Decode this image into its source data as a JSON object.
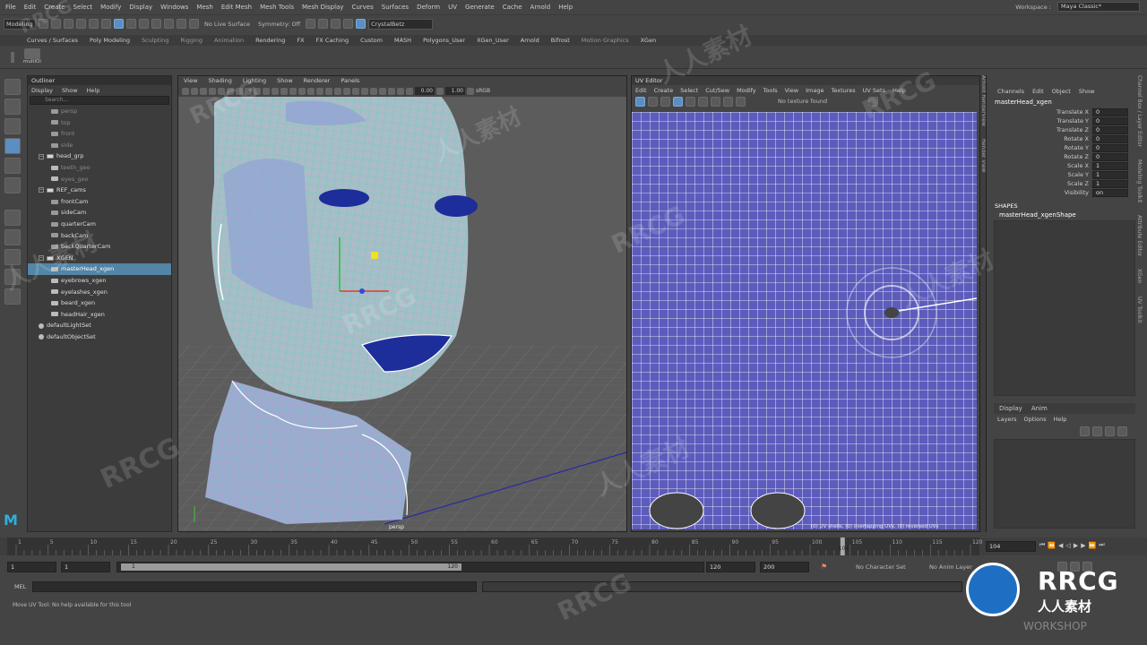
{
  "menubar": {
    "items": [
      "File",
      "Edit",
      "Create",
      "Select",
      "Modify",
      "Display",
      "Windows",
      "Mesh",
      "Edit Mesh",
      "Mesh Tools",
      "Mesh Display",
      "Curves",
      "Surfaces",
      "Deform",
      "UV",
      "Generate",
      "Cache",
      "Arnold",
      "Help"
    ]
  },
  "workspace": {
    "label": "Workspace :",
    "value": "Maya Classic*"
  },
  "statusline": {
    "mode": "Modeling",
    "live_surface": "No Live Surface",
    "symmetry": "Symmetry: Off",
    "user": "CrystalBetz"
  },
  "shelf": {
    "tabs": [
      "Curves / Surfaces",
      "Poly Modeling",
      "Sculpting",
      "Rigging",
      "Animation",
      "Rendering",
      "FX",
      "FX Caching",
      "Custom",
      "MASH",
      "Polygons_User",
      "XGen_User",
      "Arnold",
      "Bifrost",
      "Motion Graphics",
      "XGen"
    ],
    "tool_label": "multiOi"
  },
  "outliner": {
    "title": "Outliner",
    "menu": [
      "Display",
      "Show",
      "Help"
    ],
    "search_placeholder": "Search...",
    "items": [
      {
        "label": "persp",
        "level": 1,
        "icon": "cam",
        "dim": true
      },
      {
        "label": "top",
        "level": 1,
        "icon": "cam",
        "dim": true
      },
      {
        "label": "front",
        "level": 1,
        "icon": "cam",
        "dim": true
      },
      {
        "label": "side",
        "level": 1,
        "icon": "cam",
        "dim": true
      },
      {
        "label": "head_grp",
        "level": 0,
        "icon": "grp",
        "exp": true
      },
      {
        "label": "teeth_geo",
        "level": 1,
        "icon": "mesh",
        "dim": true
      },
      {
        "label": "eyes_geo",
        "level": 1,
        "icon": "mesh",
        "dim": true
      },
      {
        "label": "REF_cams",
        "level": 0,
        "icon": "grp",
        "exp": true
      },
      {
        "label": "frontCam",
        "level": 1,
        "icon": "cam"
      },
      {
        "label": "sideCam",
        "level": 1,
        "icon": "cam"
      },
      {
        "label": "quarterCam",
        "level": 1,
        "icon": "cam"
      },
      {
        "label": "backCam",
        "level": 1,
        "icon": "cam"
      },
      {
        "label": "backQuarterCam",
        "level": 1,
        "icon": "cam"
      },
      {
        "label": "XGEN",
        "level": 0,
        "icon": "grp",
        "exp": true
      },
      {
        "label": "masterHead_xgen",
        "level": 1,
        "icon": "mesh",
        "sel": true
      },
      {
        "label": "eyebrows_xgen",
        "level": 1,
        "icon": "mesh"
      },
      {
        "label": "eyelashes_xgen",
        "level": 1,
        "icon": "mesh"
      },
      {
        "label": "beard_xgen",
        "level": 1,
        "icon": "mesh"
      },
      {
        "label": "headHair_xgen",
        "level": 1,
        "icon": "mesh"
      },
      {
        "label": "defaultLightSet",
        "level": 0,
        "icon": "set"
      },
      {
        "label": "defaultObjectSet",
        "level": 0,
        "icon": "set"
      }
    ]
  },
  "viewport": {
    "menu": [
      "View",
      "Shading",
      "Lighting",
      "Show",
      "Renderer",
      "Panels"
    ],
    "val1": "0.00",
    "val2": "1.00",
    "colorspace": "sRGB",
    "camera": "persp"
  },
  "uv_editor": {
    "title": "UV Editor",
    "menu": [
      "Edit",
      "Create",
      "Select",
      "Cut/Sew",
      "Modify",
      "Tools",
      "View",
      "Image",
      "Textures",
      "UV Sets",
      "Help"
    ],
    "texture": "No texture found",
    "status": "(0) UV shells, (0) overlapping UVs, (0) reversed UVs"
  },
  "channel_box": {
    "menu": [
      "Channels",
      "Edit",
      "Object",
      "Show"
    ],
    "object": "masterHead_xgen",
    "attrs": [
      {
        "k": "Translate X",
        "v": "0"
      },
      {
        "k": "Translate Y",
        "v": "0"
      },
      {
        "k": "Translate Z",
        "v": "0"
      },
      {
        "k": "Rotate X",
        "v": "0"
      },
      {
        "k": "Rotate Y",
        "v": "0"
      },
      {
        "k": "Rotate Z",
        "v": "0"
      },
      {
        "k": "Scale X",
        "v": "1"
      },
      {
        "k": "Scale Y",
        "v": "1"
      },
      {
        "k": "Scale Z",
        "v": "1"
      },
      {
        "k": "Visibility",
        "v": "on"
      }
    ],
    "shapes_label": "SHAPES",
    "shape": "masterHead_xgenShape",
    "layer_tabs": [
      "Display",
      "Anim"
    ],
    "layer_menu": [
      "Layers",
      "Options",
      "Help"
    ]
  },
  "side_tabs": [
    "Channel Box / Layer Editor",
    "Modeling Toolkit",
    "Attribute Editor",
    "XGen",
    "UV Toolkit"
  ],
  "side_tabs_left": [
    "Arnold RenderView",
    "Render View"
  ],
  "timeline": {
    "ticks": [
      "1",
      "5",
      "10",
      "15",
      "20",
      "25",
      "30",
      "35",
      "40",
      "45",
      "50",
      "55",
      "60",
      "65",
      "70",
      "75",
      "80",
      "85",
      "90",
      "95",
      "100",
      "105",
      "110",
      "115",
      "120"
    ],
    "current": "104",
    "current_frame": "104"
  },
  "range": {
    "start": "1",
    "inner_start": "1",
    "slider_start": "1",
    "slider_end": "120",
    "end": "120",
    "anim_end": "200",
    "char_set": "No Character Set",
    "anim_layer": "No Anim Layer"
  },
  "mel": {
    "label": "MEL"
  },
  "help_line": "Move UV Tool: No help available for this tool",
  "watermarks": [
    "RRCG",
    "人人素材",
    "RRCG",
    "人人素材",
    "RRCG",
    "人人素材",
    "RRCG",
    "人人素材",
    "RRCG",
    "RRCG",
    "人人素材",
    "RRCG"
  ],
  "logo": {
    "main": "RRCG",
    "sub": "人人素材",
    "workshop": "WORKSHOP"
  },
  "colors": {
    "accent": "#5285a6",
    "uv_bg": "#5d5cbc",
    "wire": "#3fe0b5"
  }
}
